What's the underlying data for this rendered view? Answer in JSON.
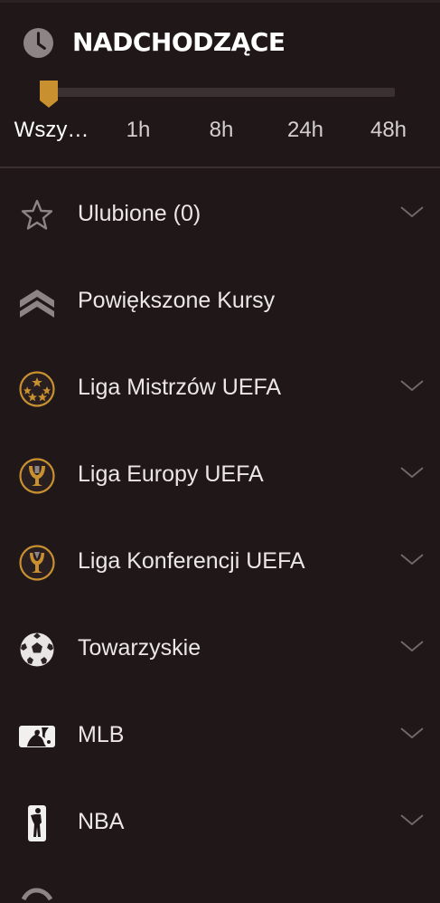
{
  "header": {
    "title": "NADCHODZĄCE",
    "icon": "clock-icon"
  },
  "time_filter": {
    "selected_index": 0,
    "options": [
      "Wszy…",
      "1h",
      "8h",
      "24h",
      "48h"
    ]
  },
  "menu": {
    "items": [
      {
        "label": "Ulubione (0)",
        "icon": "star-icon",
        "expandable": true
      },
      {
        "label": "Powiększone Kursy",
        "icon": "double-chevron-up-icon",
        "expandable": false
      },
      {
        "label": "Liga Mistrzów UEFA",
        "icon": "champions-league-icon",
        "expandable": true
      },
      {
        "label": "Liga Europy UEFA",
        "icon": "europa-league-icon",
        "expandable": true
      },
      {
        "label": "Liga Konferencji UEFA",
        "icon": "conference-league-icon",
        "expandable": true
      },
      {
        "label": "Towarzyskie",
        "icon": "soccer-ball-icon",
        "expandable": true
      },
      {
        "label": "MLB",
        "icon": "mlb-logo-icon",
        "expandable": true
      },
      {
        "label": "NBA",
        "icon": "nba-logo-icon",
        "expandable": true
      }
    ]
  },
  "colors": {
    "background": "#1f1718",
    "accent": "#c8902f",
    "text": "#ece7e7",
    "muted": "#8a8283"
  }
}
